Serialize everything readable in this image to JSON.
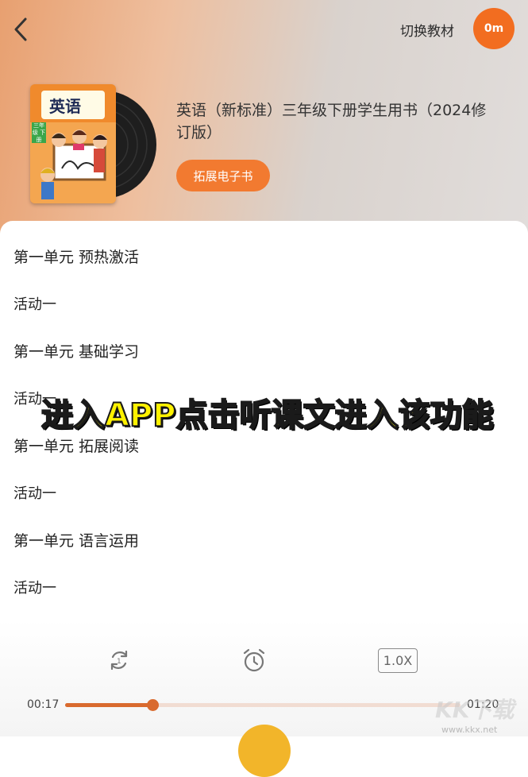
{
  "header": {
    "switch_label": "切换教材",
    "timer_badge": "0m",
    "book_cover_title": "英语",
    "book_cover_tag": "三年级 下册",
    "title": "英语（新标准）三年级下册学生用书（2024修订版）",
    "ebook_button": "拓展电子书"
  },
  "list": {
    "rows": [
      "第一单元 预热激活",
      "活动一",
      "第一单元 基础学习",
      "活动一",
      "第一单元 拓展阅读",
      "活动一",
      "第一单元 语言运用",
      "活动一"
    ]
  },
  "overlay_caption": "进入APP点击听课文进入该功能",
  "player": {
    "speed": "1.0X",
    "current_time": "00:17",
    "total_time": "01:20",
    "progress": 0.22
  },
  "watermark": {
    "logo": "KK下载",
    "url": "www.kkx.net"
  },
  "colors": {
    "accent": "#f26d20",
    "progress": "#d96a2e",
    "caption": "#fff200"
  }
}
